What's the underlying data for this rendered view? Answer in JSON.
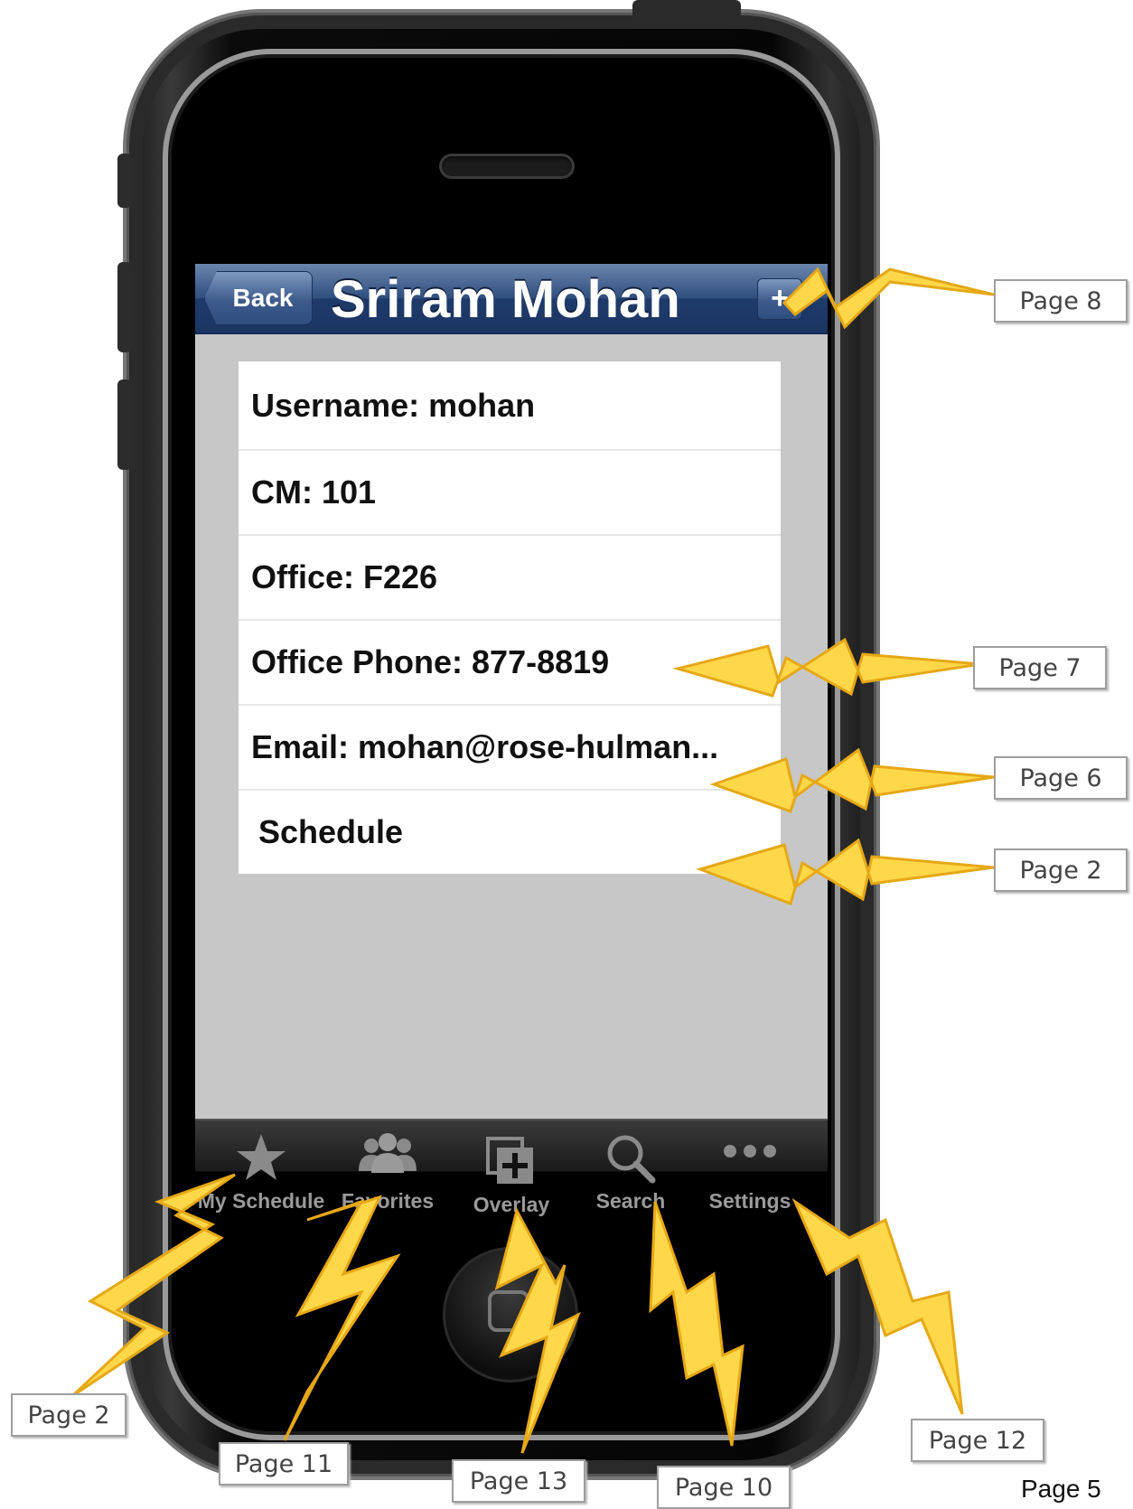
{
  "nav": {
    "back_label": "Back",
    "title": "Sriram Mohan",
    "add_label": "+"
  },
  "details": [
    {
      "text": "Username: mohan"
    },
    {
      "text": "CM: 101"
    },
    {
      "text": "Office: F226"
    },
    {
      "text": "Office Phone: 877-8819"
    },
    {
      "text": "Email: mohan@rose-hulman..."
    },
    {
      "text": "Schedule"
    }
  ],
  "tabbar": {
    "tabs": [
      {
        "label": "My Schedule",
        "icon": "star-icon"
      },
      {
        "label": "Favorites",
        "icon": "people-icon"
      },
      {
        "label": "Overlay",
        "icon": "overlay-icon"
      },
      {
        "label": "Search",
        "icon": "magnifier-icon"
      },
      {
        "label": "Settings",
        "icon": "more-dots-icon"
      }
    ]
  },
  "annotations": {
    "add_button": "Page 8",
    "office_phone": "Page 7",
    "email": "Page 6",
    "schedule": "Page 2",
    "tab_my_schedule": "Page 2",
    "tab_favorites": "Page 11",
    "tab_overlay": "Page 13",
    "tab_search": "Page 10",
    "tab_settings": "Page 12"
  },
  "page_number": "Page 5",
  "colors": {
    "nav_blue": "#1f3b6a",
    "screen_bg": "#c7c7c7",
    "bolt_fill": "#ffd84a",
    "bolt_stroke": "#e6a817"
  }
}
